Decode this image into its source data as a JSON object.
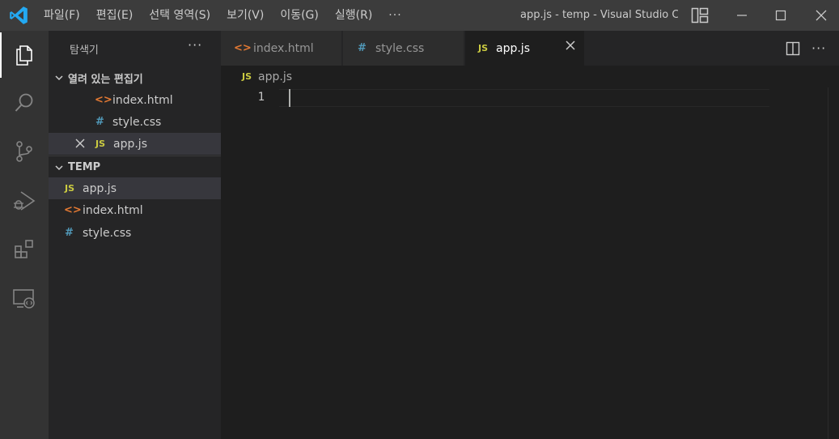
{
  "window": {
    "title": "app.js - temp - Visual Studio Code",
    "menu": [
      "파일(F)",
      "편집(E)",
      "선택 영역(S)",
      "보기(V)",
      "이동(G)",
      "실행(R)"
    ],
    "more": "···"
  },
  "sidebar": {
    "title": "탐색기",
    "more": "···",
    "open_editors": {
      "label": "열려 있는 편집기",
      "items": [
        {
          "icon": "<>",
          "label": "index.html"
        },
        {
          "icon": "#",
          "label": "style.css"
        },
        {
          "icon": "JS",
          "label": "app.js"
        }
      ]
    },
    "folder": {
      "label": "TEMP",
      "items": [
        {
          "icon": "JS",
          "label": "app.js"
        },
        {
          "icon": "<>",
          "label": "index.html"
        },
        {
          "icon": "#",
          "label": "style.css"
        }
      ]
    }
  },
  "tabs": [
    {
      "icon": "<>",
      "label": "index.html"
    },
    {
      "icon": "#",
      "label": "style.css"
    },
    {
      "icon": "JS",
      "label": "app.js"
    }
  ],
  "breadcrumb": {
    "icon": "JS",
    "label": "app.js"
  },
  "editor": {
    "line_number": "1"
  },
  "colors": {
    "titlebar": "#3c3c3c",
    "activitybar": "#333333",
    "sidebar": "#252526",
    "editor": "#1e1e1e",
    "html_icon": "#e37933",
    "css_icon": "#519aba",
    "js_icon": "#cbcb41",
    "vscode_blue": "#23a9f2"
  }
}
